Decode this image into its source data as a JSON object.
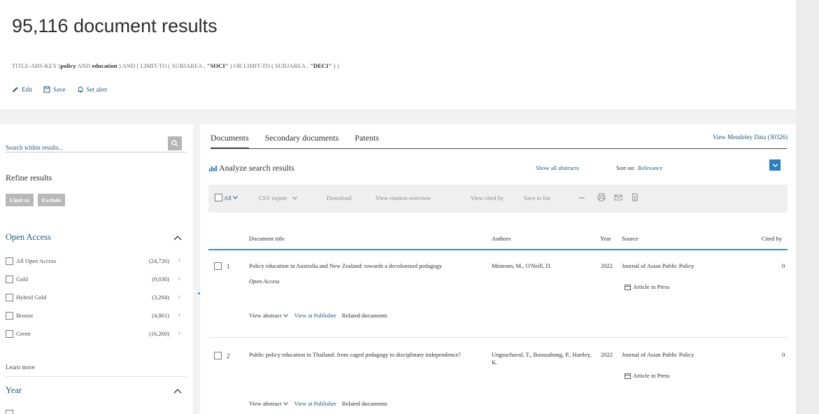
{
  "header": {
    "title": "95,116 document results",
    "query": {
      "prefix": "TITLE-ABS-KEY (",
      "term1": "policy",
      "and1": " AND ",
      "term2": "education",
      "mid": " ) AND ( LIMIT-TO ( SUBJAREA , ",
      "val1": "\"SOCI\"",
      "mid2": " ) OR LIMIT-TO ( SUBJAREA , ",
      "val2": "\"DECI\"",
      "suffix": " ) )"
    },
    "actions": {
      "edit": "Edit",
      "save": "Save",
      "set_alert": "Set alert"
    }
  },
  "sidebar": {
    "search_placeholder": "Search within results...",
    "refine_title": "Refine results",
    "limit_to": "Limit to",
    "exclude": "Exclude",
    "open_access": {
      "title": "Open Access",
      "items": [
        {
          "label": "All Open Access",
          "count": "(24,726)"
        },
        {
          "label": "Gold",
          "count": "(9,030)"
        },
        {
          "label": "Hybrid Gold",
          "count": "(3,294)"
        },
        {
          "label": "Bronze",
          "count": "(4,861)"
        },
        {
          "label": "Green",
          "count": "(16,260)"
        }
      ],
      "learn_more": "Learn more"
    },
    "year": {
      "title": "Year"
    }
  },
  "main": {
    "tabs": [
      "Documents",
      "Secondary documents",
      "Patents"
    ],
    "mendeley": "View Mendeley Data (30326)",
    "analyze": "Analyze search results",
    "show_all_abstracts": "Show all abstracts",
    "sort_on_label": "Sort on:",
    "sort_on_value": "Relevance",
    "toolbar": {
      "all": "All",
      "csv_export": "CSV export",
      "download": "Download",
      "view_citation_overview": "View citation overview",
      "view_cited_by": "View cited by",
      "save_to_list": "Save to list",
      "more": "•••"
    },
    "columns": {
      "title": "Document title",
      "authors": "Authors",
      "year": "Year",
      "source": "Source",
      "cited_by": "Cited by"
    },
    "rows": [
      {
        "num": "1",
        "title": "Policy education in Australia and New Zealand: towards a decolonized pedagogy",
        "open_access": "Open Access",
        "authors": "Mintrom, M., O'Neill, D.",
        "year": "2022",
        "source": "Journal of Asian Public Policy",
        "badge": "Article in Press",
        "cited": "0",
        "view_abstract": "View abstract",
        "view_publisher": "View at Publisher",
        "related": "Related documents"
      },
      {
        "num": "2",
        "title": "Public policy education in Thailand: from caged pedagogy to disciplinary independence?",
        "open_access": "",
        "authors": "Ungsuchaval, T., Boossabong, P., Hartley, K.",
        "year": "2022",
        "source": "Journal of Asian Public Policy",
        "badge": "Article in Press",
        "cited": "0",
        "view_abstract": "View abstract",
        "view_publisher": "View at Publisher",
        "related": "Related documents"
      }
    ]
  }
}
